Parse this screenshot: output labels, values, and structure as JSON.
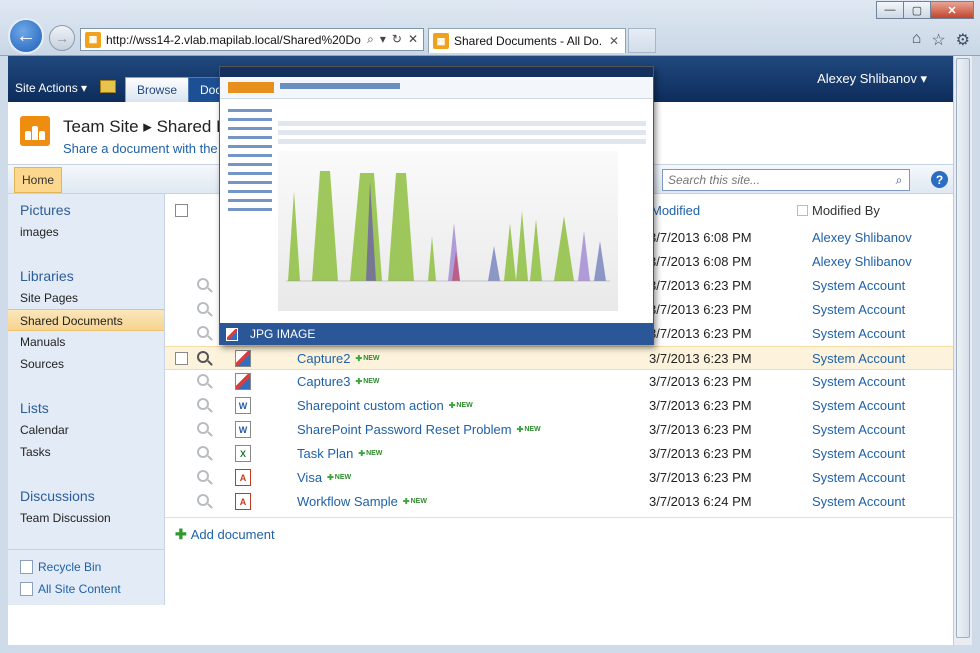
{
  "browser": {
    "address": "http://wss14-2.vlab.mapilab.local/Shared%20Do",
    "tab_title": "Shared Documents - All Do...",
    "tab_close": "✕"
  },
  "ribbon": {
    "site_actions": "Site Actions ▾",
    "tabs": [
      "Browse",
      "Doc"
    ],
    "user": "Alexey Shlibanov ▾"
  },
  "title_area": {
    "site_title": "Team Site ▸ Shared D",
    "description": "Share a document with the"
  },
  "topnav": {
    "home": "Home",
    "search_placeholder": "Search this site...",
    "help": "?"
  },
  "quicklaunch": {
    "sections": [
      {
        "heading": "Pictures",
        "items": [
          "images"
        ]
      },
      {
        "heading": "Libraries",
        "items": [
          "Site Pages",
          "Shared Documents",
          "Manuals",
          "Sources"
        ]
      },
      {
        "heading": "Lists",
        "items": [
          "Calendar",
          "Tasks"
        ]
      },
      {
        "heading": "Discussions",
        "items": [
          "Team Discussion"
        ]
      }
    ],
    "recycle_bin": "Recycle Bin",
    "all_site_content": "All Site Content"
  },
  "list": {
    "columns": {
      "modified": "Modified",
      "modified_by": "Modified By"
    },
    "new_label": "NEW",
    "rows": [
      {
        "name": "",
        "icon": "",
        "modified": "3/7/2013 6:08 PM",
        "modified_by": "Alexey Shlibanov"
      },
      {
        "name": "",
        "icon": "",
        "modified": "3/7/2013 6:08 PM",
        "modified_by": "Alexey Shlibanov"
      },
      {
        "name": "",
        "icon": "",
        "modified": "3/7/2013 6:23 PM",
        "modified_by": "System Account"
      },
      {
        "name": "",
        "icon": "",
        "modified": "3/7/2013 6:23 PM",
        "modified_by": "System Account"
      },
      {
        "name": "",
        "icon": "",
        "modified": "3/7/2013 6:23 PM",
        "modified_by": "System Account"
      },
      {
        "name": "Capture2",
        "icon": "jpg",
        "modified": "3/7/2013 6:23 PM",
        "modified_by": "System Account"
      },
      {
        "name": "Capture3",
        "icon": "jpg",
        "modified": "3/7/2013 6:23 PM",
        "modified_by": "System Account"
      },
      {
        "name": "Sharepoint custom action",
        "icon": "word",
        "modified": "3/7/2013 6:23 PM",
        "modified_by": "System Account"
      },
      {
        "name": "SharePoint Password Reset Problem",
        "icon": "word",
        "modified": "3/7/2013 6:23 PM",
        "modified_by": "System Account"
      },
      {
        "name": "Task Plan",
        "icon": "excel",
        "modified": "3/7/2013 6:23 PM",
        "modified_by": "System Account"
      },
      {
        "name": "Visa",
        "icon": "pdf",
        "modified": "3/7/2013 6:23 PM",
        "modified_by": "System Account"
      },
      {
        "name": "Workflow Sample",
        "icon": "pdf",
        "modified": "3/7/2013 6:24 PM",
        "modified_by": "System Account"
      }
    ],
    "add_document": "Add document"
  },
  "preview": {
    "label": "JPG IMAGE"
  }
}
